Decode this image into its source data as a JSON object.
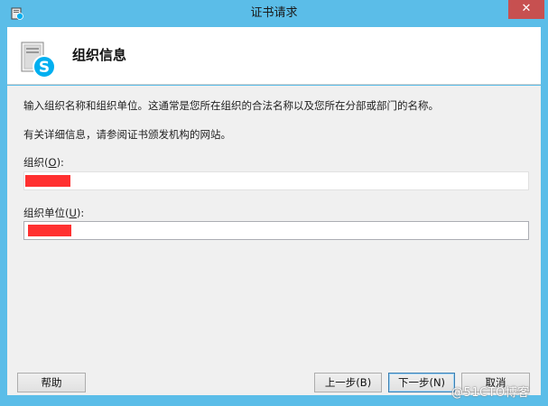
{
  "window": {
    "title": "证书请求",
    "close_glyph": "✕"
  },
  "header": {
    "title": "组织信息",
    "icon": "skype-certificate-icon"
  },
  "content": {
    "description": "输入组织名称和组织单位。这通常是您所在组织的合法名称以及您所在分部或部门的名称。",
    "more_info": "有关详细信息，请参阅证书颁发机构的网站。",
    "org_label_prefix": "组织(",
    "org_label_key": "O",
    "org_label_suffix": "):",
    "org_value": "",
    "unit_label_prefix": "组织单位(",
    "unit_label_key": "U",
    "unit_label_suffix": "):",
    "unit_value": ""
  },
  "buttons": {
    "help": "帮助",
    "prev": "上一步(B)",
    "next": "下一步(N)",
    "cancel": "取消"
  },
  "watermark": "@51CTO博客",
  "colors": {
    "titlebar": "#5bbde8",
    "close": "#c75050",
    "redaction": "#ff3030",
    "accent_skype": "#00aff0"
  }
}
